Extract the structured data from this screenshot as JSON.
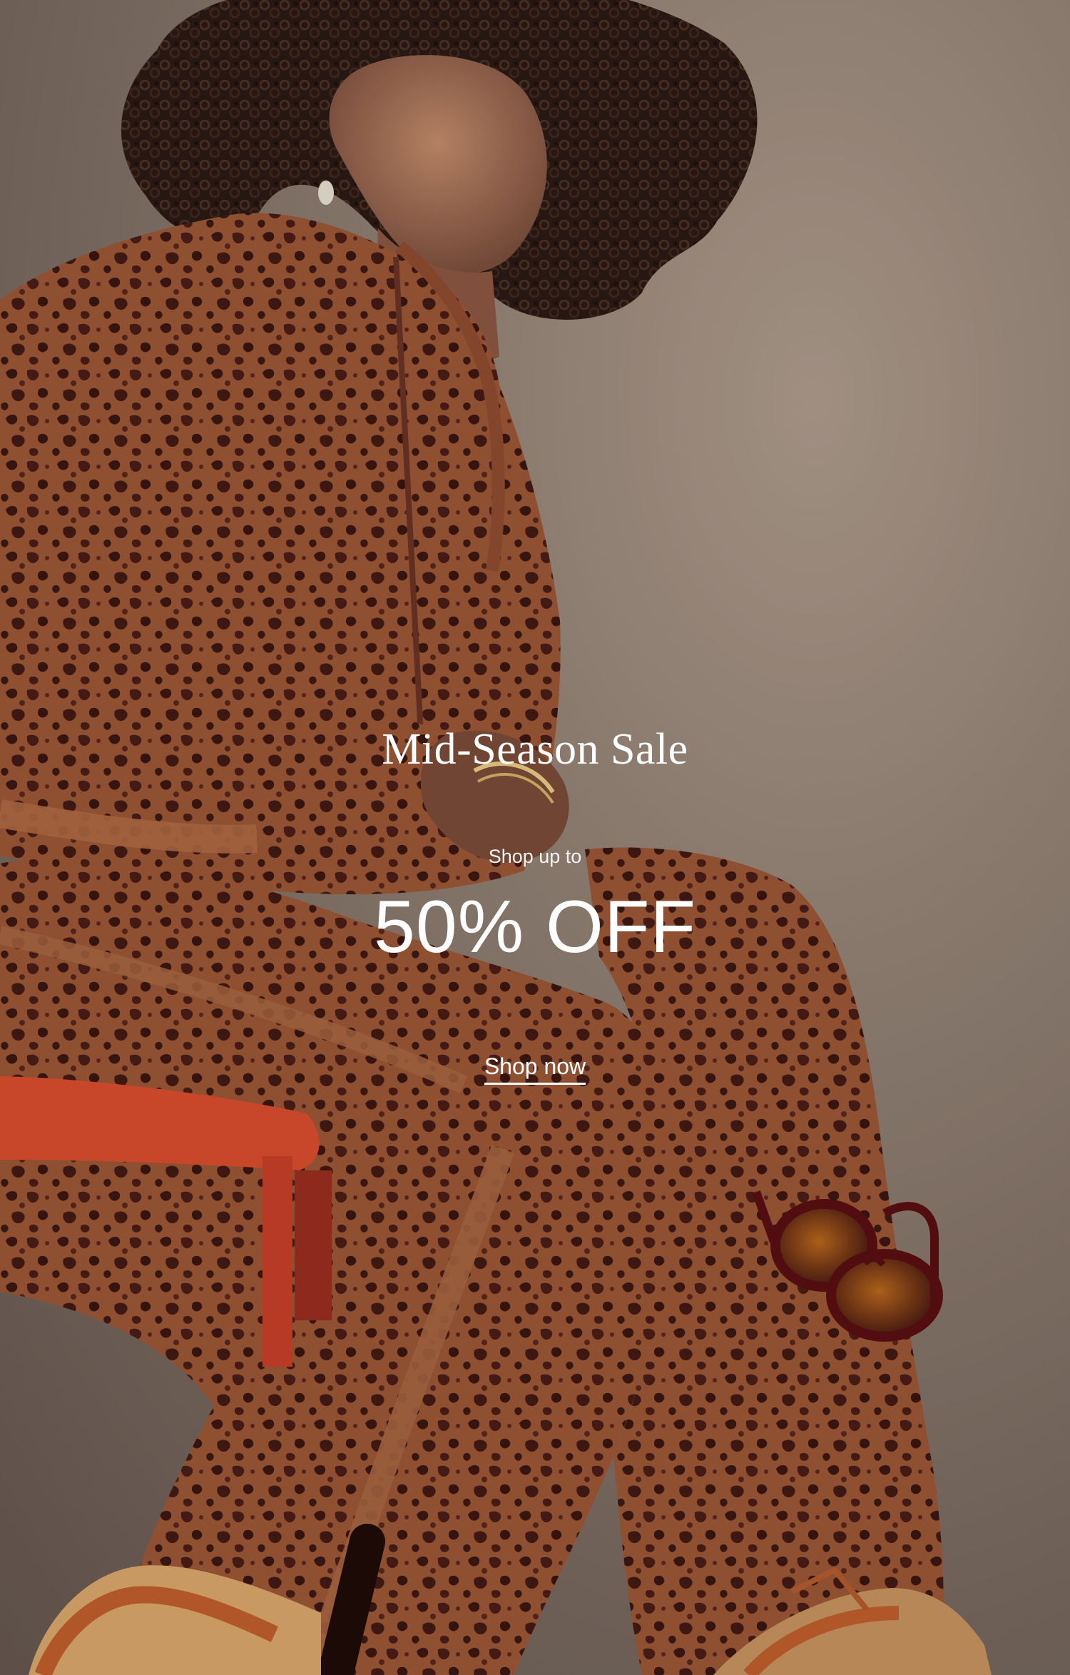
{
  "hero": {
    "title": "Mid-Season Sale",
    "subtitle": "Shop up to",
    "discount": "50% OFF",
    "cta_label": "Shop now"
  },
  "colors": {
    "text": "#ffffff",
    "background": "#8f7b6d",
    "accent_chair": "#d94d2e"
  }
}
